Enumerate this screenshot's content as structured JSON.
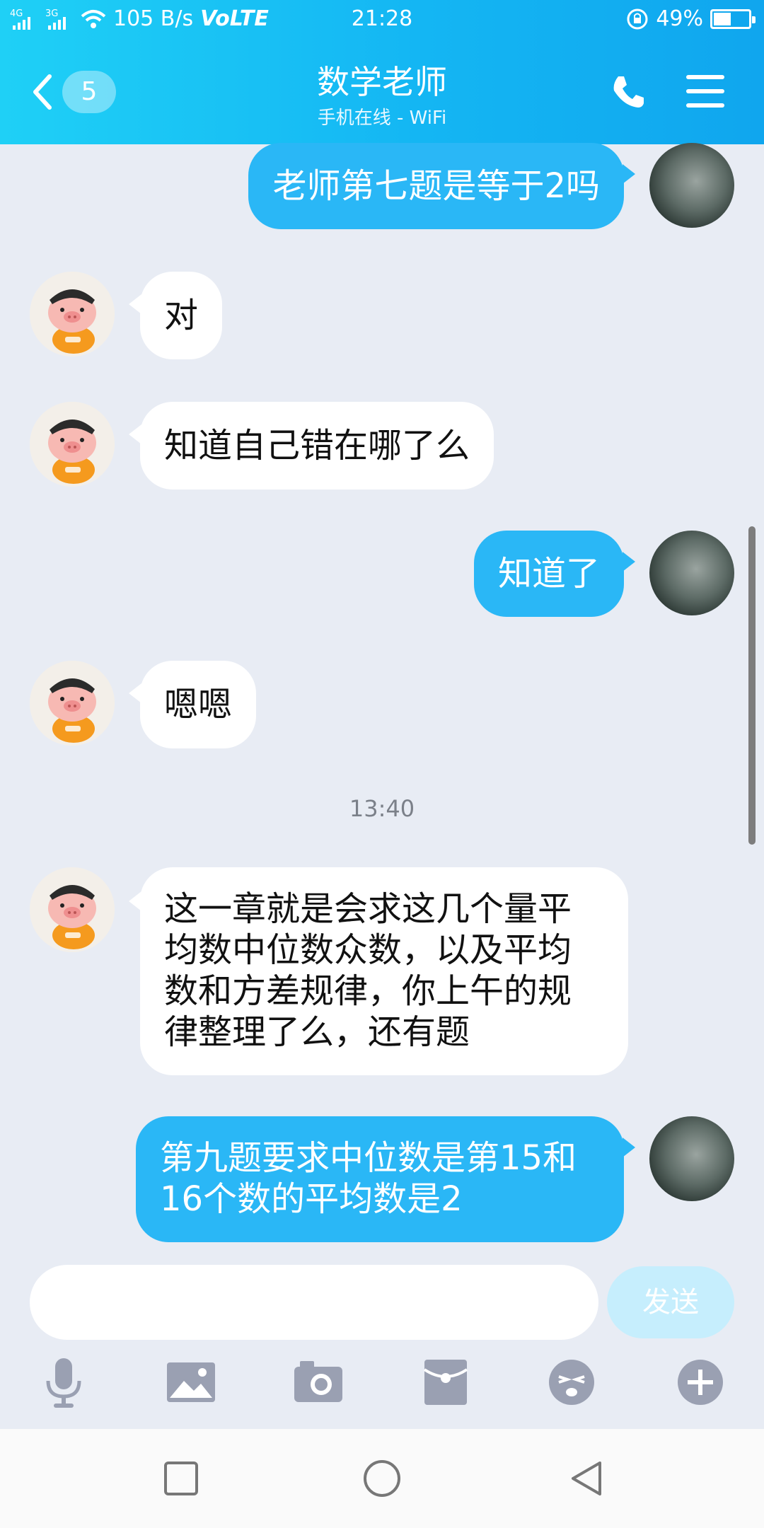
{
  "status_bar": {
    "net_label_1": "4G",
    "net_label_2": "3G",
    "speed": "105 B/s",
    "volte": "VoLTE",
    "time": "21:28",
    "battery_percent": "49%",
    "battery_level": 0.49
  },
  "header": {
    "unread_count": "5",
    "title": "数学老师",
    "subtitle": "手机在线 - WiFi"
  },
  "messages": [
    {
      "sender": "me",
      "text": "老师第七题是等于2吗"
    },
    {
      "sender": "teacher",
      "text": "对"
    },
    {
      "sender": "teacher",
      "text": "知道自己错在哪了么"
    },
    {
      "sender": "me",
      "text": "知道了"
    },
    {
      "sender": "teacher",
      "text": "嗯嗯"
    },
    {
      "type": "timestamp",
      "text": "13:40"
    },
    {
      "sender": "teacher",
      "lines": [
        "这一章就是会求这几个量平",
        "均数中位数众数，以及平均",
        "数和方差规律，你上午的规",
        "律整理了么，还有题"
      ]
    },
    {
      "sender": "me",
      "lines": [
        "第九题要求中位数是第15和",
        "16个数的平均数是2"
      ]
    }
  ],
  "input": {
    "value": "",
    "send_label": "发送"
  },
  "toolbar": [
    "microphone-icon",
    "image-icon",
    "camera-icon",
    "red-packet-icon",
    "emoji-icon",
    "plus-icon"
  ],
  "colors": {
    "header_start": "#1fd0f6",
    "header_end": "#10a6ee",
    "outgoing_bubble": "#2ab7f6",
    "incoming_bubble": "#ffffff",
    "chat_background": "#e8ecf4",
    "send_button": "#c6eefd"
  }
}
